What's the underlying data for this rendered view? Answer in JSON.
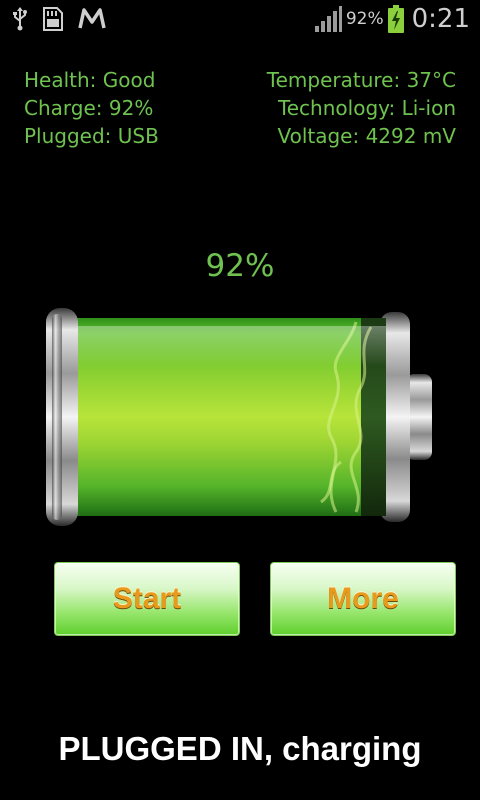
{
  "status_bar": {
    "battery_percent": "92%",
    "time": "0:21",
    "icons": [
      "usb-icon",
      "sd-card-icon",
      "gmail-icon",
      "signal-icon",
      "battery-charging-icon"
    ]
  },
  "info": {
    "health": "Health: Good",
    "charge": "Charge: 92%",
    "plugged": "Plugged: USB",
    "temperature": "Temperature: 37°C",
    "technology": "Technology: Li-ion",
    "voltage": "Voltage: 4292 mV"
  },
  "battery": {
    "percent_label": "92%",
    "level": 0.92
  },
  "buttons": {
    "start_label": "Start",
    "more_label": "More"
  },
  "status_message": "PLUGGED IN, charging",
  "colors": {
    "accent_green": "#6fc24f",
    "button_text": "#e89a1c"
  }
}
